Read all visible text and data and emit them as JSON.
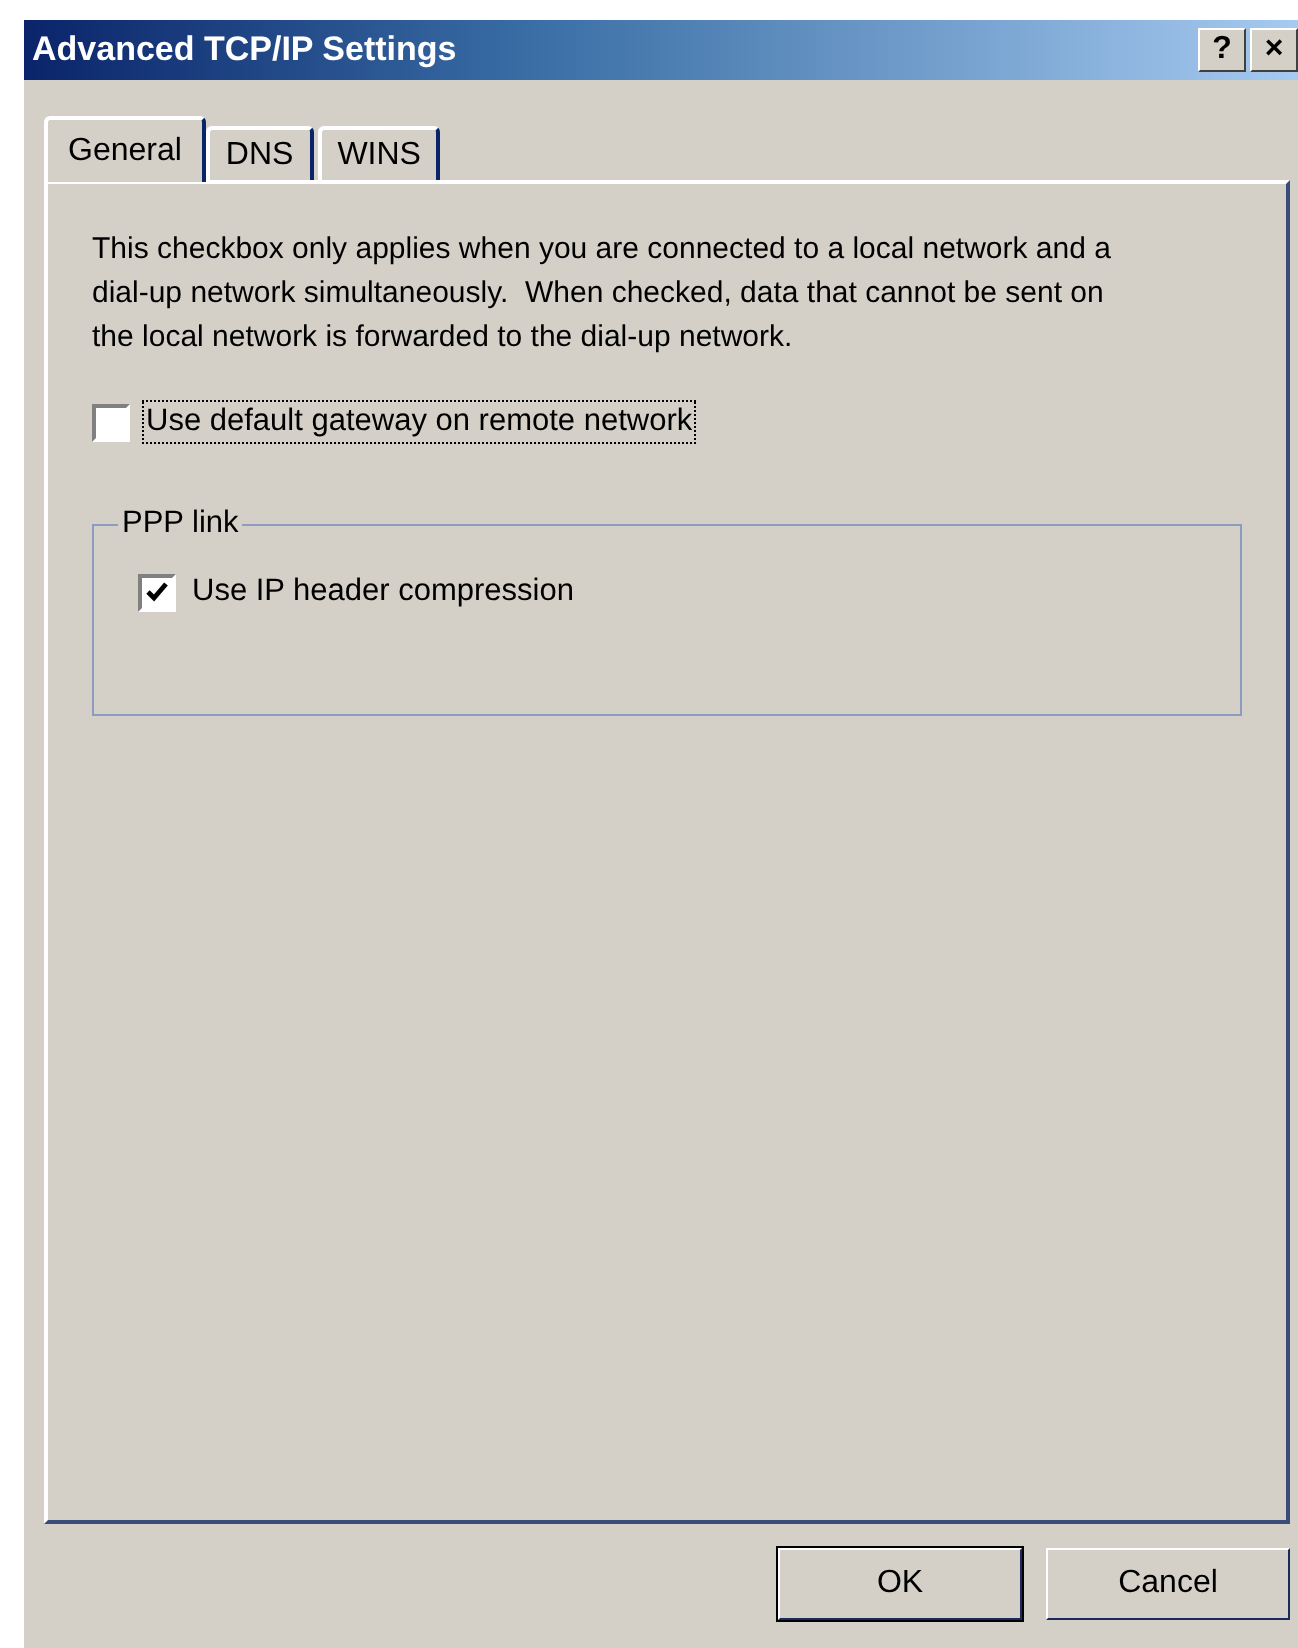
{
  "window": {
    "title": "Advanced TCP/IP Settings",
    "title_buttons": [
      "?",
      "×"
    ]
  },
  "tabs": [
    {
      "label": "General",
      "selected": true
    },
    {
      "label": "DNS",
      "selected": false
    },
    {
      "label": "WINS",
      "selected": false
    }
  ],
  "description": "This checkbox only applies when you are connected to a local network and a dial-up network simultaneously.  When checked, data that cannot be sent on the local network is forwarded to the dial-up network.",
  "gateway_checkbox": {
    "label": "Use default gateway on remote network",
    "checked": false,
    "focused": true
  },
  "ppp_group": {
    "title": "PPP link",
    "checkboxes": [
      {
        "label": "Use IP header compression",
        "checked": true
      }
    ]
  },
  "buttons": [
    "OK",
    "Cancel"
  ]
}
